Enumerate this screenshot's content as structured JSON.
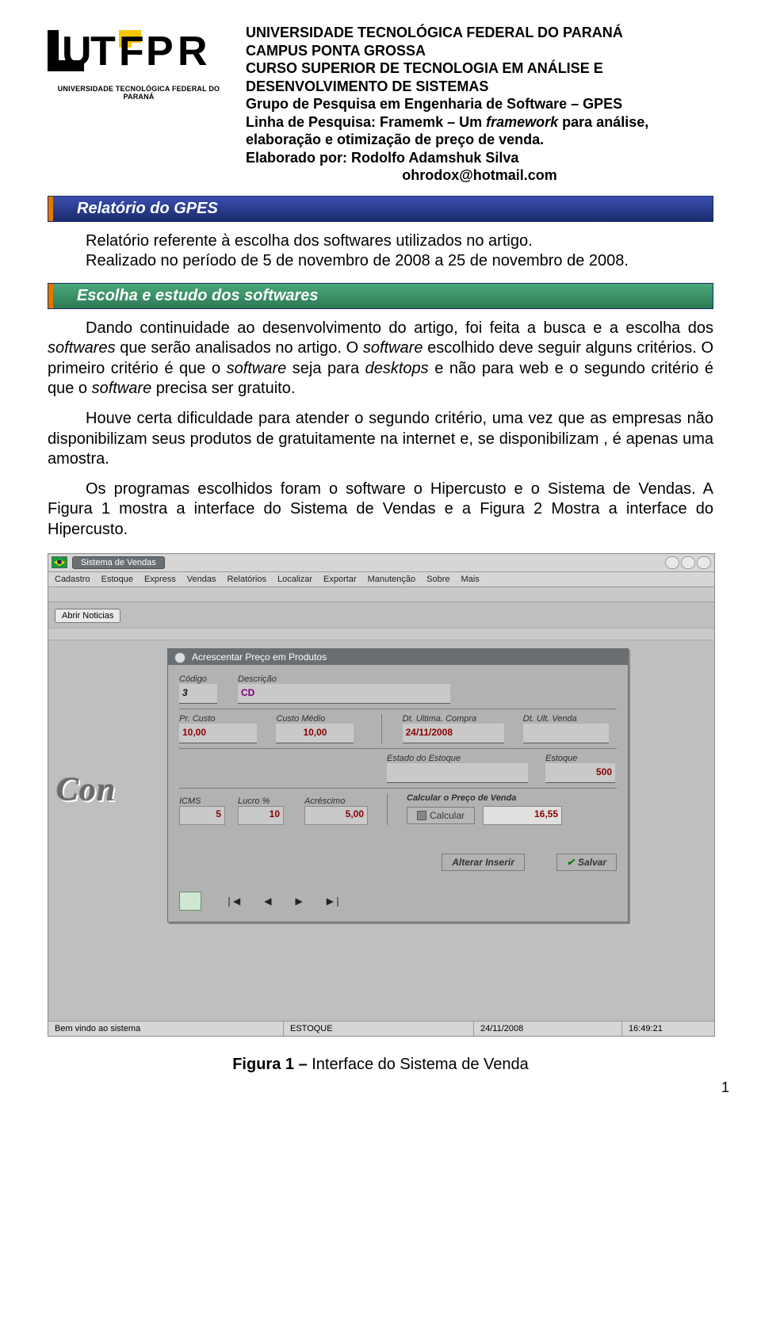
{
  "header": {
    "logo_caption": "UNIVERSIDADE TECNOLÓGICA FEDERAL DO PARANÁ",
    "l1": "UNIVERSIDADE TECNOLÓGICA FEDERAL DO PARANÁ",
    "l2": "CAMPUS PONTA GROSSA",
    "l3": "CURSO SUPERIOR DE TECNOLOGIA EM ANÁLISE E DESENVOLVIMENTO DE SISTEMAS",
    "l4": "Grupo de Pesquisa em Engenharia de Software – GPES",
    "l5a": "Linha de Pesquisa: Framemk – Um ",
    "l5b_italic": "framework",
    "l5c": " para análise, elaboração e otimização de preço de venda.",
    "l6": "Elaborado por: Rodolfo Adamshuk Silva",
    "email": "ohrodox@hotmail.com"
  },
  "bands": {
    "relatorio": "Relatório do GPES",
    "escolha": "Escolha e estudo dos softwares"
  },
  "paragraphs": {
    "p1a": "Relatório referente à escolha dos softwares utilizados no artigo.",
    "p1b": "Realizado no período de 5 de novembro de 2008 a 25 de novembro de 2008.",
    "p2a": "Dando continuidade ao desenvolvimento do artigo, foi feita a busca e a escolha dos ",
    "p2b_italic": "softwares",
    "p2c": " que serão analisados no artigo. O ",
    "p2d_italic": "software",
    "p2e": " escolhido deve seguir alguns critérios. O primeiro critério é que o ",
    "p2f_italic": "software",
    "p2g": " seja para ",
    "p2h_italic": "desktops",
    "p2i": " e não para web e o segundo critério é que o ",
    "p2j_italic": "software",
    "p2k": " precisa ser gratuito.",
    "p3": "Houve certa dificuldade para atender o segundo critério, uma vez que as empresas não disponibilizam seus produtos de gratuitamente na internet e, se disponibilizam , é apenas uma amostra.",
    "p4": "Os programas escolhidos foram o software o Hipercusto e o Sistema de Vendas. A Figura 1 mostra a interface do Sistema de Vendas e a Figura 2 Mostra a interface do Hipercusto."
  },
  "figure": {
    "caption_bold": "Figura 1 – ",
    "caption_rest": "Interface do Sistema de Venda"
  },
  "app": {
    "title": "Sistema de Vendas",
    "menu": [
      "Cadastro",
      "Estoque",
      "Express",
      "Vendas",
      "Relatórios",
      "Localizar",
      "Exportar",
      "Manutenção",
      "Sobre",
      "Mais"
    ],
    "btn_noticias": "Abrir Noticias",
    "brand_partial": "Con",
    "dialog": {
      "title": "Acrescentar Preço em Produtos",
      "labels": {
        "codigo": "Código",
        "descricao": "Descrição",
        "pr_custo": "Pr. Custo",
        "custo_medio": "Custo Médio",
        "dt_ult_compra": "Dt. Ultima. Compra",
        "dt_ult_venda": "Dt. Ult. Venda",
        "estado_estoque": "Estado do Estoque",
        "estoque": "Estoque",
        "icms": "ICMS",
        "lucro": "Lucro %",
        "acrescimo": "Acréscimo",
        "calcular_preco": "Calcular o Preço de Venda"
      },
      "values": {
        "codigo": "3",
        "descricao": "CD",
        "pr_custo": "10,00",
        "custo_medio": "10,00",
        "dt_ult_compra": "24/11/2008",
        "dt_ult_venda": "",
        "estado_estoque": "",
        "estoque": "500",
        "icms": "5",
        "lucro": "10",
        "acrescimo": "5,00",
        "preco_venda": "16,55"
      },
      "buttons": {
        "calcular": "Calcular",
        "alterar": "Alterar  Inserir",
        "salvar": "Salvar"
      }
    },
    "status": {
      "s1": "Bem vindo ao sistema",
      "s2": "ESTOQUE",
      "s3": "24/11/2008",
      "s4": "16:49:21"
    }
  },
  "pagenum": "1"
}
